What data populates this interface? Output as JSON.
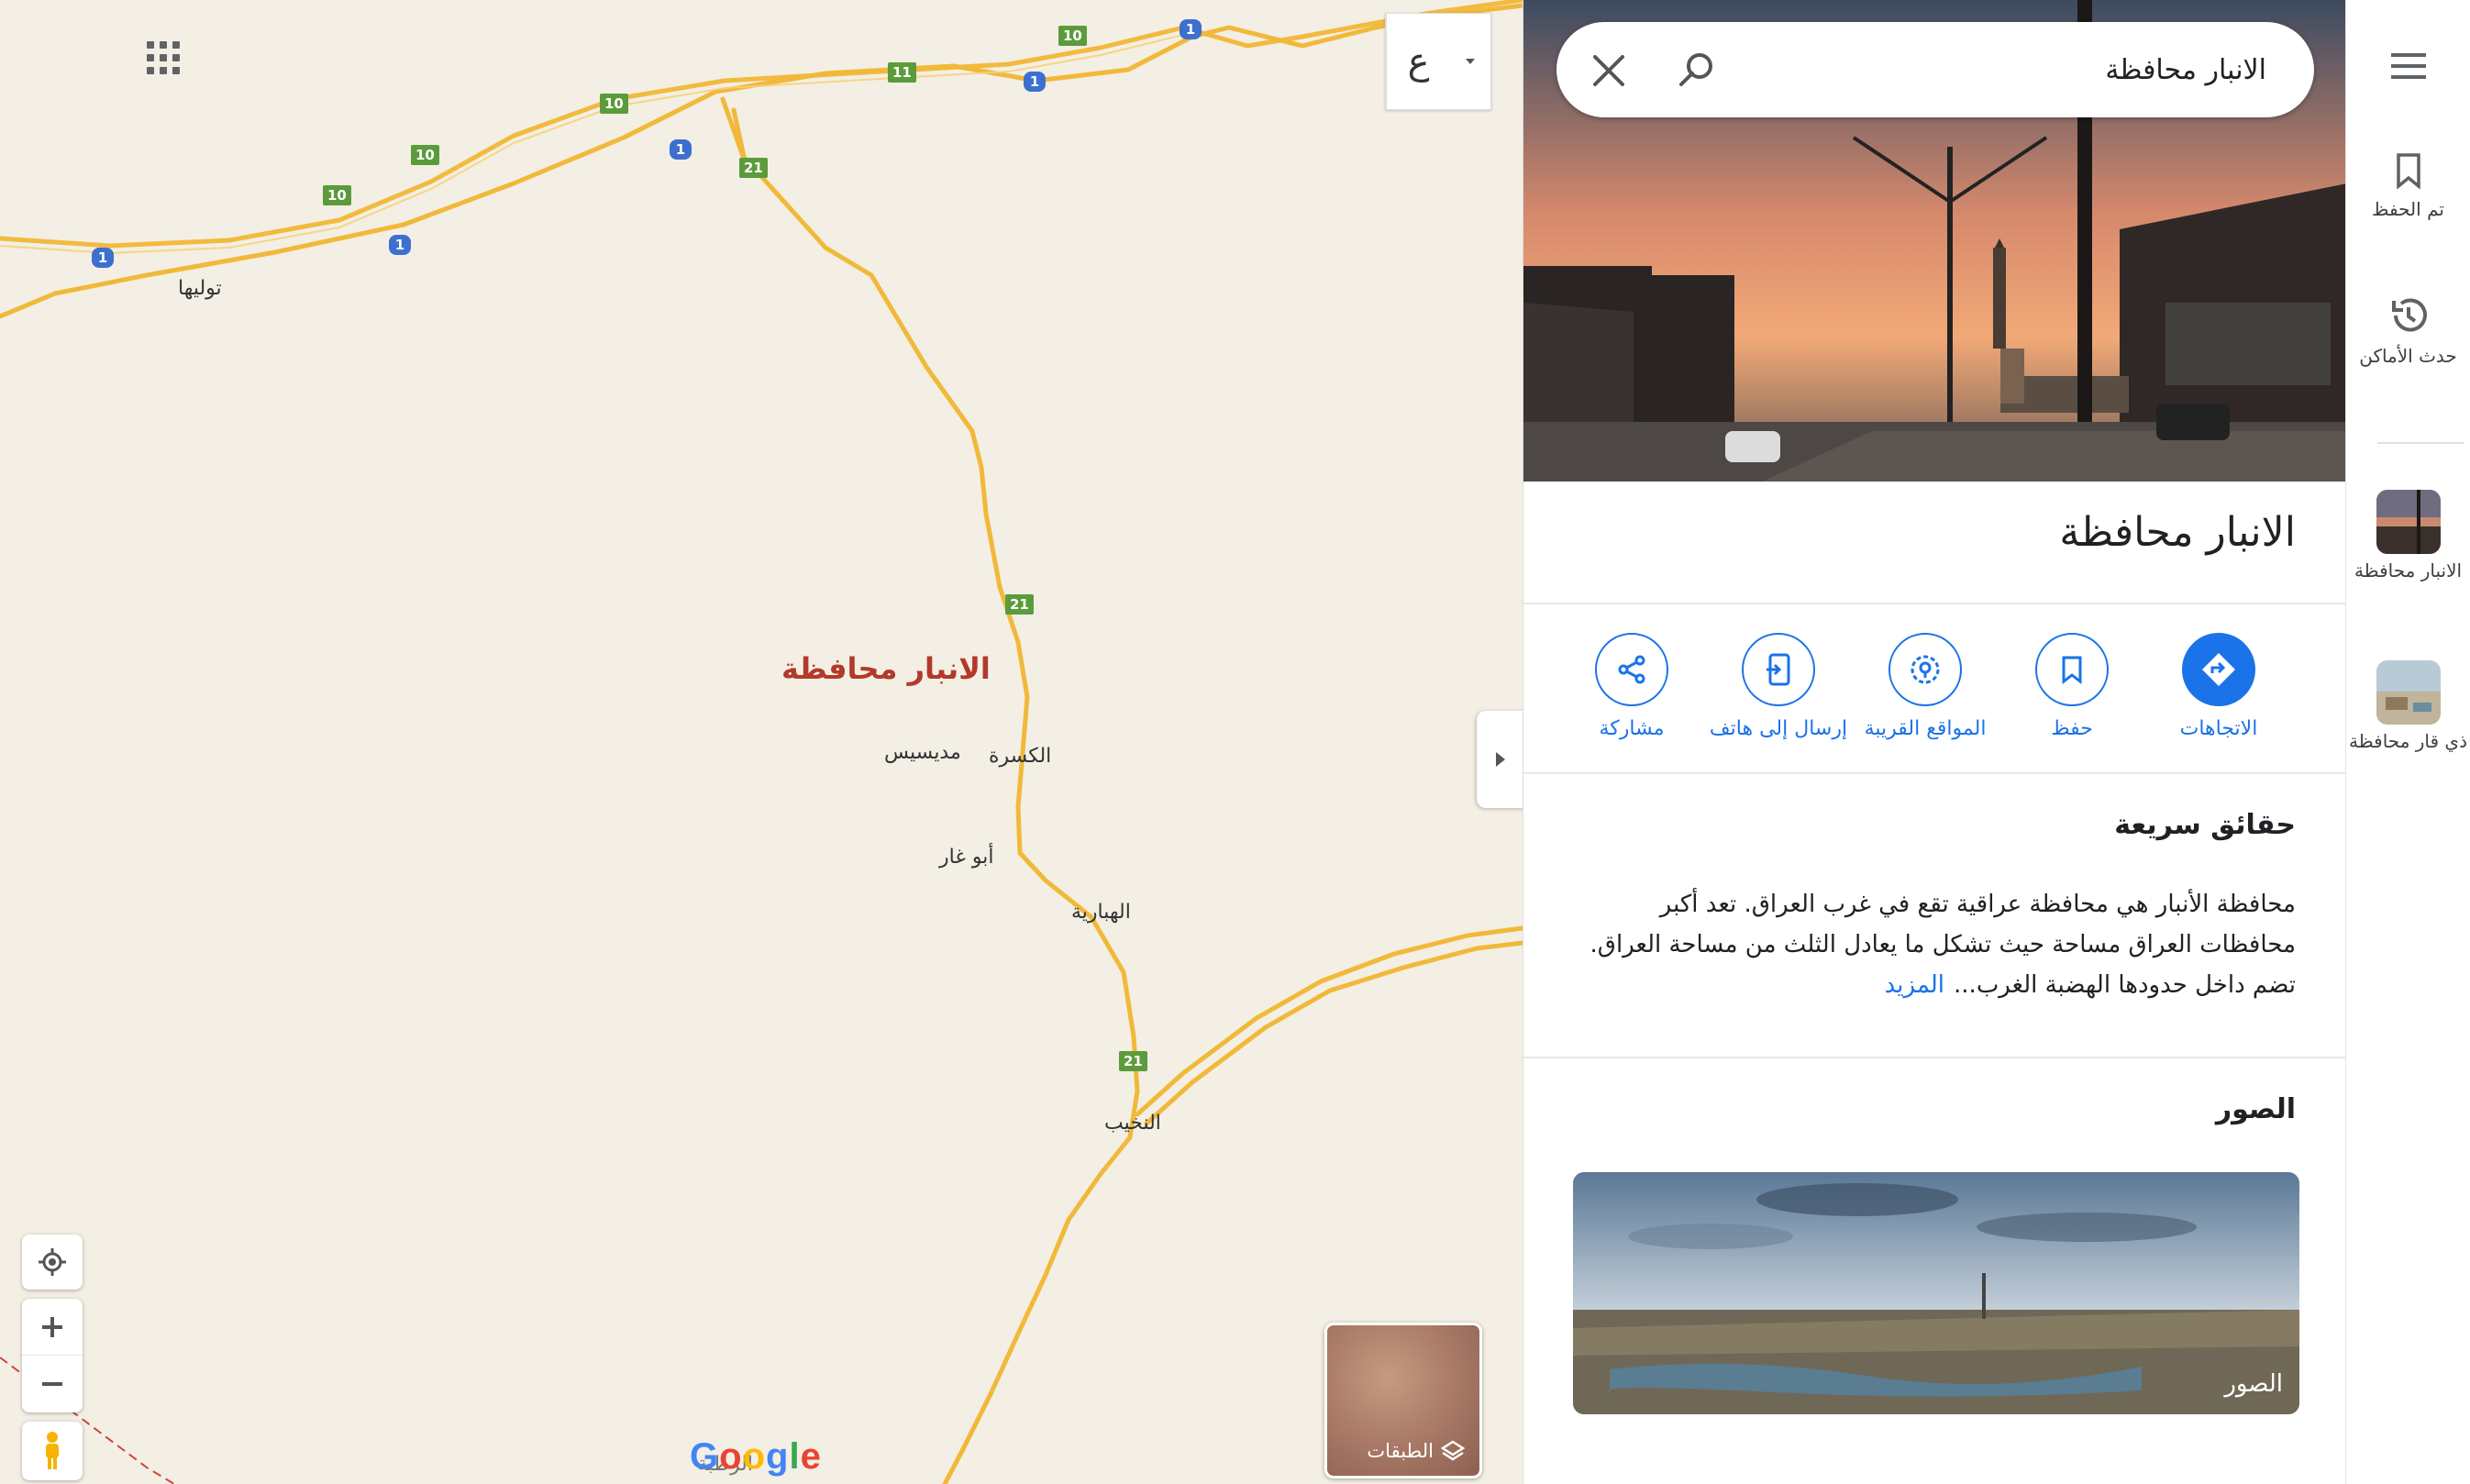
{
  "search": {
    "query": "الانبار محافظة"
  },
  "map": {
    "region_label": "الانبار محافظة",
    "places": [
      "توليها",
      "الكسرة",
      "مديسيس",
      "أبو غار",
      "الهبارية",
      "النخيب",
      "الرطبة"
    ],
    "shields": {
      "route_1": "1",
      "route_10": "10",
      "route_11": "11",
      "route_21": "21"
    },
    "language_button": "ع",
    "layers_label": "الطبقات",
    "logo": "Google"
  },
  "place": {
    "title": "الانبار محافظة",
    "actions": [
      {
        "label": "الاتجاهات"
      },
      {
        "label": "حفظ"
      },
      {
        "label": "المواقع القريبة"
      },
      {
        "label": "إرسال إلى هاتف"
      },
      {
        "label": "مشاركة"
      }
    ],
    "quick_facts_title": "حقائق سريعة",
    "quick_facts_text": "محافظة الأنبار هي محافظة عراقية تقع في غرب العراق. تعد أكبر محافظات العراق مساحة حيث تشكل ما يعادل الثلث من مساحة العراق. تضم داخل حدودها الهضبة الغرب...",
    "more_link": "المزيد",
    "photos_title": "الصور",
    "photos_label": "الصور"
  },
  "rail": {
    "saved_label": "تم الحفظ",
    "recent_label": "حدث الأماكن",
    "recent_places": [
      {
        "label": "الانبار محافظة"
      },
      {
        "label": "ذي قار محافظة"
      }
    ]
  },
  "colors": {
    "accent": "#1a73e8",
    "map_bg": "#f3efe4",
    "road": "#f5c043",
    "region_label": "#b23a2b"
  }
}
